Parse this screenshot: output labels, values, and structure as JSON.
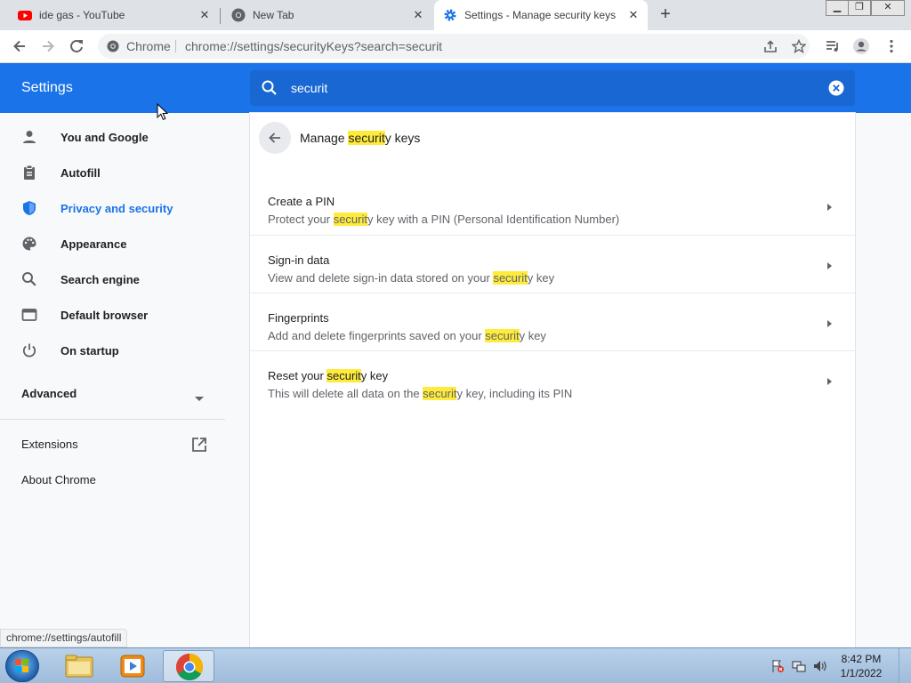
{
  "browser": {
    "tabs": [
      {
        "title": "ide gas - YouTube",
        "favicon": "youtube-icon"
      },
      {
        "title": "New Tab",
        "favicon": "chrome-icon"
      },
      {
        "title": "Settings - Manage security keys",
        "favicon": "settings-gear-icon",
        "active": true
      }
    ],
    "omnibox": {
      "site_label": "Chrome",
      "url": "chrome://settings/securityKeys?search=securit"
    },
    "status_bubble": "chrome://settings/autofill"
  },
  "settings": {
    "title": "Settings",
    "search_value": "securit",
    "sidebar": {
      "items": [
        {
          "label": "You and Google",
          "icon": "person-icon"
        },
        {
          "label": "Autofill",
          "icon": "clipboard-icon"
        },
        {
          "label": "Privacy and security",
          "icon": "shield-icon",
          "active": true
        },
        {
          "label": "Appearance",
          "icon": "palette-icon"
        },
        {
          "label": "Search engine",
          "icon": "search-icon"
        },
        {
          "label": "Default browser",
          "icon": "browser-window-icon"
        },
        {
          "label": "On startup",
          "icon": "power-icon"
        }
      ],
      "advanced_label": "Advanced",
      "extensions_label": "Extensions",
      "about_label": "About Chrome"
    },
    "page": {
      "title_pre": "Manage ",
      "title_hl": "securit",
      "title_post": "y keys",
      "rows": [
        {
          "title": "Create a PIN",
          "desc_pre": "Protect your ",
          "desc_hl": "securit",
          "desc_post": "y key with a PIN (Personal Identification Number)"
        },
        {
          "title": "Sign-in data",
          "desc_pre": "View and delete sign-in data stored on your ",
          "desc_hl": "securit",
          "desc_post": "y key"
        },
        {
          "title": "Fingerprints",
          "desc_pre": "Add and delete fingerprints saved on your ",
          "desc_hl": "securit",
          "desc_post": "y key"
        },
        {
          "title_pre": "Reset your ",
          "title_hl": "securit",
          "title_post": "y key",
          "desc_pre": "This will delete all data on the ",
          "desc_hl": "securit",
          "desc_post": "y key, including its PIN"
        }
      ]
    }
  },
  "taskbar": {
    "time": "8:42 PM",
    "date": "1/1/2022"
  },
  "colors": {
    "accent": "#1a73e8",
    "highlight": "#ffeb3b"
  }
}
